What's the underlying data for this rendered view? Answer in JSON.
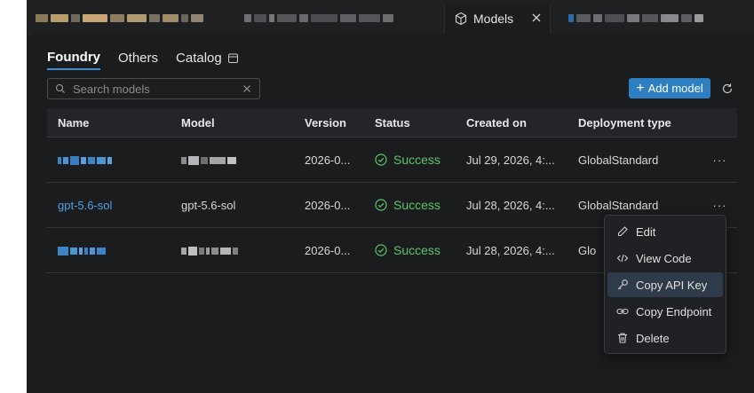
{
  "tabs": {
    "active_label": "Models"
  },
  "subtabs": [
    "Foundry",
    "Others",
    "Catalog"
  ],
  "search": {
    "placeholder": "Search models"
  },
  "toolbar": {
    "add_label": "Add model"
  },
  "table": {
    "headers": [
      "Name",
      "Model",
      "Version",
      "Status",
      "Created on",
      "Deployment type"
    ],
    "rows": [
      {
        "name": "",
        "model": "",
        "version": "2026-0...",
        "status": "Success",
        "created": "Jul 29, 2026, 4:...",
        "deployment": "GlobalStandard"
      },
      {
        "name": "gpt-5.6-sol",
        "model": "gpt-5.6-sol",
        "version": "2026-0...",
        "status": "Success",
        "created": "Jul 28, 2026, 4:...",
        "deployment": "GlobalStandard"
      },
      {
        "name": "",
        "model": "",
        "version": "2026-0...",
        "status": "Success",
        "created": "Jul 28, 2026, 4:...",
        "deployment": "Glo"
      }
    ]
  },
  "context_menu": {
    "items": [
      {
        "label": "Edit",
        "icon": "pencil-icon"
      },
      {
        "label": "View Code",
        "icon": "code-icon"
      },
      {
        "label": "Copy API Key",
        "icon": "key-icon"
      },
      {
        "label": "Copy Endpoint",
        "icon": "link-icon"
      },
      {
        "label": "Delete",
        "icon": "trash-icon"
      }
    ]
  },
  "colors": {
    "accent": "#2d7fc1",
    "link": "#4aa3e8",
    "success": "#5bc46a",
    "background": "#1b1c1e"
  }
}
